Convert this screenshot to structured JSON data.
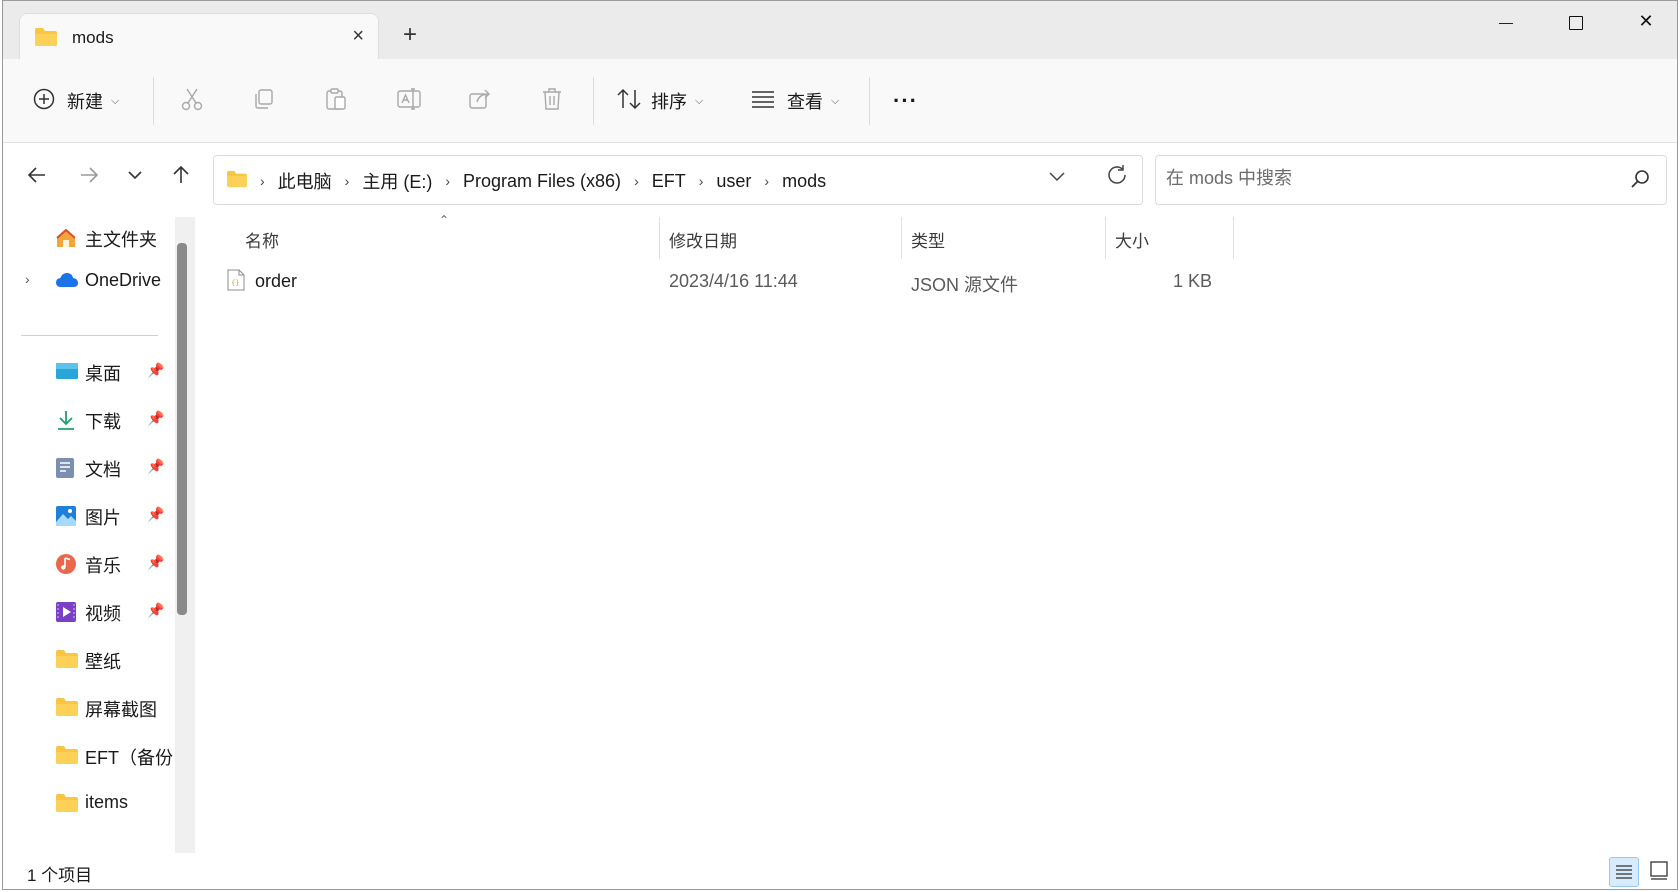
{
  "tab": {
    "title": "mods",
    "close_label": "×",
    "new_tab_label": "+"
  },
  "window_controls": {
    "minimize": "—",
    "close": "✕"
  },
  "toolbar": {
    "new_label": "新建",
    "sort_label": "排序",
    "view_label": "查看",
    "more_label": "···"
  },
  "address": {
    "crumbs": [
      "此电脑",
      "主用 (E:)",
      "Program Files (x86)",
      "EFT",
      "user",
      "mods"
    ]
  },
  "search": {
    "placeholder": "在 mods 中搜索"
  },
  "sidebar": {
    "items": [
      {
        "label": "主文件夹"
      },
      {
        "label": "OneDrive"
      },
      {
        "label": "桌面"
      },
      {
        "label": "下载"
      },
      {
        "label": "文档"
      },
      {
        "label": "图片"
      },
      {
        "label": "音乐"
      },
      {
        "label": "视频"
      },
      {
        "label": "壁纸"
      },
      {
        "label": "屏幕截图"
      },
      {
        "label": "EFT（备份"
      },
      {
        "label": "items"
      }
    ]
  },
  "columns": {
    "name": "名称",
    "modified": "修改日期",
    "type": "类型",
    "size": "大小"
  },
  "files": [
    {
      "name": "order",
      "modified": "2023/4/16 11:44",
      "type": "JSON 源文件",
      "size": "1 KB"
    }
  ],
  "status": {
    "item_count": "1 个项目"
  },
  "colors": {
    "folder": "#f7c744",
    "accent": "#0067c0"
  }
}
